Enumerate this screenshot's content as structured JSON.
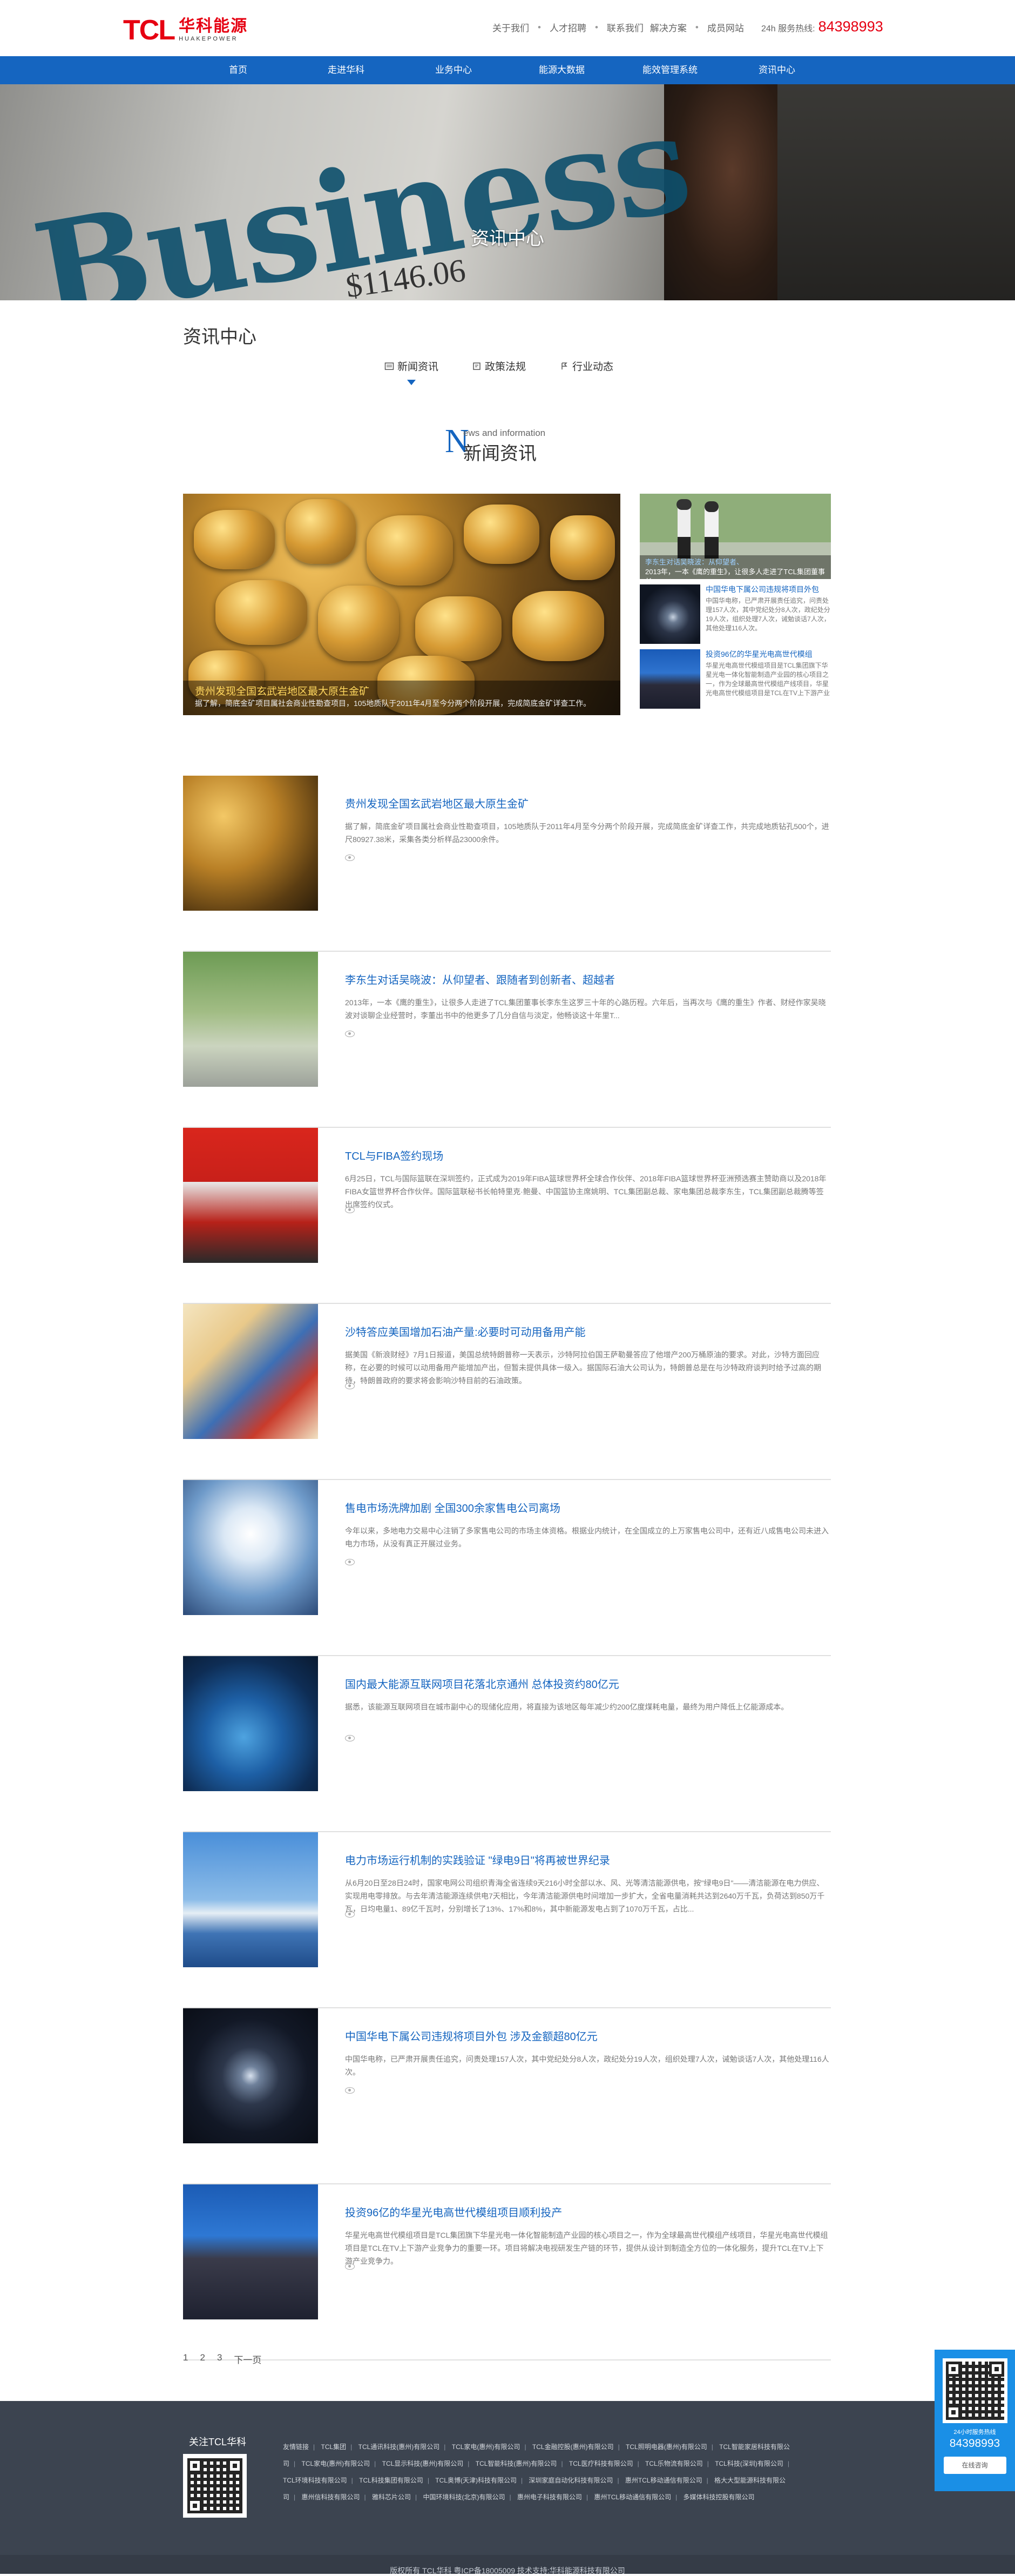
{
  "header": {
    "logo_tcl": "TCL",
    "logo_cn": "华科能源",
    "logo_en": "HUAKEPOWER",
    "links": [
      "关于我们",
      "人才招聘",
      "联系我们",
      "解决方案",
      "成员网站"
    ],
    "hotline_label": "24h 服务热线:",
    "hotline_number": "84398993"
  },
  "nav": {
    "items": [
      "首页",
      "走进华科",
      "业务中心",
      "能源大数据",
      "能效管理系统",
      "资讯中心"
    ]
  },
  "banner": {
    "word": "Business",
    "number": "$1146.06",
    "title": "资讯中心"
  },
  "section": {
    "title": "资讯中心",
    "tabs": [
      {
        "label": "新闻资讯",
        "icon": "newspaper-icon",
        "active": true
      },
      {
        "label": "政策法规",
        "icon": "document-icon",
        "active": false
      },
      {
        "label": "行业动态",
        "icon": "trend-icon",
        "active": false
      }
    ]
  },
  "news_heading": {
    "letter": "N",
    "small": "ews and information",
    "cn": "新闻资讯"
  },
  "featured": {
    "main_title": "贵州发现全国玄武岩地区最大原生金矿",
    "main_text": "据了解，简底金矿项目属社会商业性勘查项目，105地质队于2011年4月至今分两个阶段开展，完成简底金矿详查工作。",
    "side_caption_title": "李东生对话吴晓波：从仰望者、",
    "side_caption_text": "2013年，一本《鹰的重生》，让很多人走进了TCL集团董事长",
    "side_items": [
      {
        "title": "中国华电下属公司违规将项目外包",
        "text": "中国华电称，已严肃开展责任追究，问责处理157人次，其中党纪处分8人次，政纪处分19人次，组织处理7人次，诫勉谈话7人次，其他处理116人次。"
      },
      {
        "title": "投资96亿的华星光电高世代模组",
        "text": "华星光电高世代模组项目是TCL集团旗下华星光电一体化智能制造产业园的核心项目之一，作为全球最高世代模组产线项目，华星光电高世代模组项目是TCL在TV上下游产业竞争力。"
      }
    ]
  },
  "news_list": [
    {
      "title": "贵州发现全国玄武岩地区最大原生金矿",
      "text": "据了解，简底金矿项目属社会商业性勘查项目，105地质队于2011年4月至今分两个阶段开展，完成简底金矿详查工作，共完成地质钻孔500个，进尺80927.38米，采集各类分析样品23000余件。"
    },
    {
      "title": "李东生对话吴晓波：从仰望者、跟随者到创新者、超越者",
      "text": "2013年，一本《鹰的重生》，让很多人走进了TCL集团董事长李东生这罗三十年的心路历程。六年后，当再次与《鹰的重生》作者、财经作家吴晓波对谈聊企业经营时，李董出书中的他更多了几分自信与淡定，他畅谈这十年里T..."
    },
    {
      "title": "TCL与FIBA签约现场",
      "text": "6月25日，TCL与国际篮联在深圳签约，正式成为2019年FIBA篮球世界杯全球合作伙伴、2018年FIBA篮球世界杯亚洲预选赛主赞助商以及2018年FIBA女篮世界杯合作伙伴。国际篮联秘书长帕特里克·鲍曼、中国篮协主席姚明、TCL集团副总裁、家电集团总裁李东生，TCL集团副总裁腾等签出席签约仪式。"
    },
    {
      "title": "沙特答应美国增加石油产量:必要时可动用备用产能",
      "text": "据美国《新浪财经》7月1日报道，美国总统特朗普称一天表示，沙特阿拉伯国王萨勒曼答应了他增产200万桶原油的要求。对此，沙特方面回应称，在必要的时候可以动用备用产能增加产出，但暂未提供具体一级入。据国际石油大公司认为，特朗普总是在与沙特政府谈判时给予过高的期待，特朗普政府的要求将会影响沙特目前的石油政策。"
    },
    {
      "title": "售电市场洗牌加剧 全国300余家售电公司离场",
      "text": "今年以来，多地电力交易中心注销了多家售电公司的市场主体资格。根据业内统计，在全国成立的上万家售电公司中，还有近八成售电公司未进入电力市场，从没有真正开展过业务。"
    },
    {
      "title": "国内最大能源互联网项目花落北京通州 总体投资约80亿元",
      "text": "据悉，该能源互联网项目在城市副中心的现储化应用，将直接为该地区每年减少约200亿度煤耗电量，最终为用户降低上亿能源成本。"
    },
    {
      "title": "电力市场运行机制的实践验证 \"绿电9日\"将再被世界纪录",
      "text": "从6月20日至28日24时，国家电网公司组织青海全省连续9天216小时全部以水、风、光等清洁能源供电，按\"绿电9日\"——清洁能源在电力供应、实现用电零排放。与去年清洁能源连续供电7天相比，今年清洁能源供电时间增加一步扩大，全省电量消耗共达到2640万千瓦，负荷达到850万千瓦，日均电量1、89亿千瓦时，分别增长了13%、17%和8%，其中新能源发电占到了1070万千瓦，占比..."
    },
    {
      "title": "中国华电下属公司违规将项目外包 涉及金额超80亿元",
      "text": "中国华电称，已严肃开展责任追究，问责处理157人次，其中党纪处分8人次，政纪处分19人次，组织处理7人次，诫勉谈话7人次，其他处理116人次。"
    },
    {
      "title": "投资96亿的华星光电高世代模组项目顺利投产",
      "text": "华星光电高世代模组项目是TCL集团旗下华星光电一体化智能制造产业园的核心项目之一，作为全球最高世代模组产线项目，华星光电高世代模组项目是TCL在TV上下游产业竞争力的重要一环。项目将解决电视研发生产链的环节，提供从设计到制造全方位的一体化服务，提升TCL在TV上下游产业竞争力。"
    }
  ],
  "pager": [
    "1",
    "2",
    "3",
    "下一页"
  ],
  "footer": {
    "follow": "关注TCL华科",
    "links": [
      "友情链接",
      "TCL集团",
      "TCL通讯科技(惠州)有限公司",
      "TCL家电(惠州)有限公司",
      "TCL金融控股(惠州)有限公司",
      "TCL照明电器(惠州)有限公司",
      "TCL智能家居科技有限公司",
      "TCL家电(惠州)有限公司",
      "TCL显示科技(惠州)有限公司",
      "TCL智能科技(惠州)有限公司",
      "TCL医疗科技有限公司",
      "TCL乐物流有限公司",
      "TCL科技(深圳)有限公司",
      "TCL环境科技有限公司",
      "TCL科技集团有限公司",
      "TCL奥博(天津)科技有限公司",
      "深圳家庭自动化科技有限公司",
      "惠州TCL移动通信有限公司",
      "格大大型能源科技有限公司",
      "惠州信科技有限公司",
      "雅科芯片公司",
      "中国环境科技(北京)有限公司",
      "惠州电子科技有限公司",
      "惠州TCL移动通信有限公司",
      "多媒体科技控股有限公司"
    ],
    "copyright": "版权所有 TCL华科 粤ICP备18005009 技术支持:华科能源科技有限公司"
  },
  "float": {
    "label": "24小时服务热线",
    "number": "84398993",
    "button": "在线咨询"
  },
  "colors": {
    "brand_red": "#e60012",
    "nav_blue": "#1565c0",
    "footer_bg": "#3c4450",
    "float_blue": "#1a8fe6"
  }
}
